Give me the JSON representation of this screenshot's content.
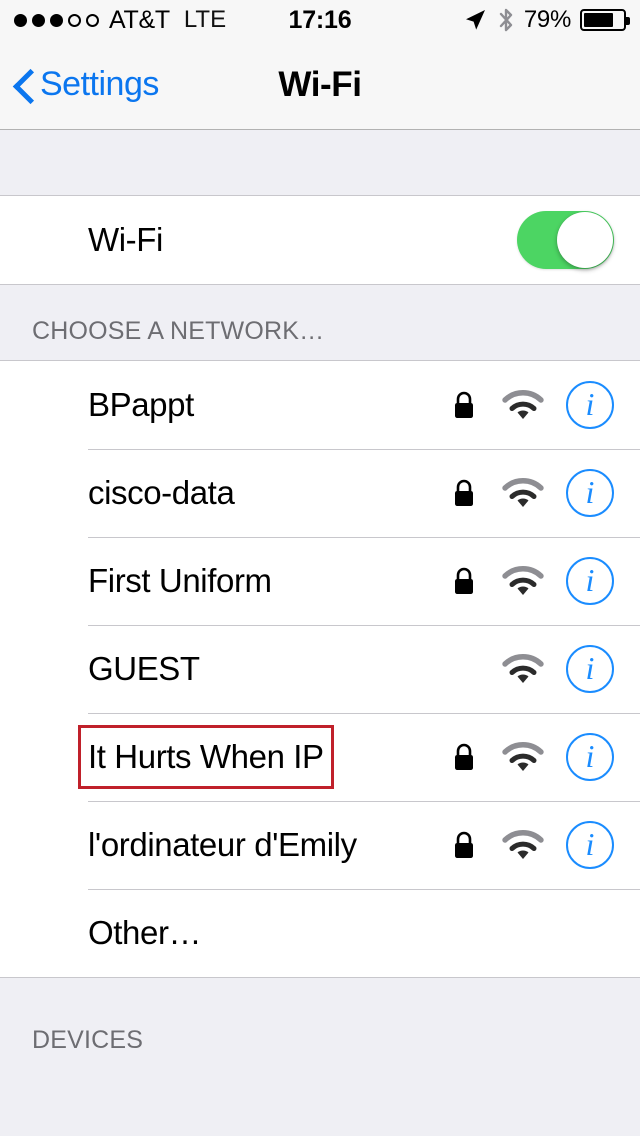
{
  "status_bar": {
    "signal_dots_filled": 3,
    "signal_dots_total": 5,
    "carrier": "AT&T",
    "radio_tech": "LTE",
    "time": "17:16",
    "location_icon": "location-arrow-icon",
    "bluetooth_icon": "bluetooth-icon",
    "battery_percent": "79%",
    "battery_level": 75
  },
  "nav_bar": {
    "back_label": "Settings",
    "back_icon": "chevron-left-icon",
    "title": "Wi-Fi"
  },
  "wifi_toggle_row": {
    "label": "Wi-Fi",
    "toggle_state": "on",
    "toggle_on_color": "#4CD563"
  },
  "network_section": {
    "header": "CHOOSE A NETWORK…",
    "rows": [
      {
        "name": "BPappt",
        "secured": true,
        "signal_icon": "wifi-signal-icon",
        "info_icon": "info-icon",
        "has_info": true
      },
      {
        "name": "cisco-data",
        "secured": true,
        "signal_icon": "wifi-signal-icon",
        "info_icon": "info-icon",
        "has_info": true
      },
      {
        "name": "First Uniform",
        "secured": true,
        "signal_icon": "wifi-signal-icon",
        "info_icon": "info-icon",
        "has_info": true
      },
      {
        "name": "GUEST",
        "secured": false,
        "signal_icon": "wifi-signal-icon",
        "info_icon": "info-icon",
        "has_info": true
      },
      {
        "name": "It Hurts When IP",
        "secured": true,
        "signal_icon": "wifi-signal-icon",
        "info_icon": "info-icon",
        "has_info": true,
        "highlighted": true
      },
      {
        "name": "l'ordinateur d'Emily",
        "secured": true,
        "signal_icon": "wifi-signal-icon",
        "info_icon": "info-icon",
        "has_info": true
      },
      {
        "name": "Other…",
        "secured": false,
        "signal_icon": null,
        "info_icon": null,
        "has_info": false
      }
    ]
  },
  "devices_section": {
    "header": "DEVICES"
  },
  "colors": {
    "accent_blue": "#0B76EF",
    "info_blue": "#1A8CFF",
    "toggle_green": "#4CD563",
    "group_background": "#EFEFF4",
    "row_background": "#FFFFFF",
    "separator": "#C8C7CC",
    "secondary_text": "#6D6D72",
    "highlight_red": "#C0202A"
  }
}
